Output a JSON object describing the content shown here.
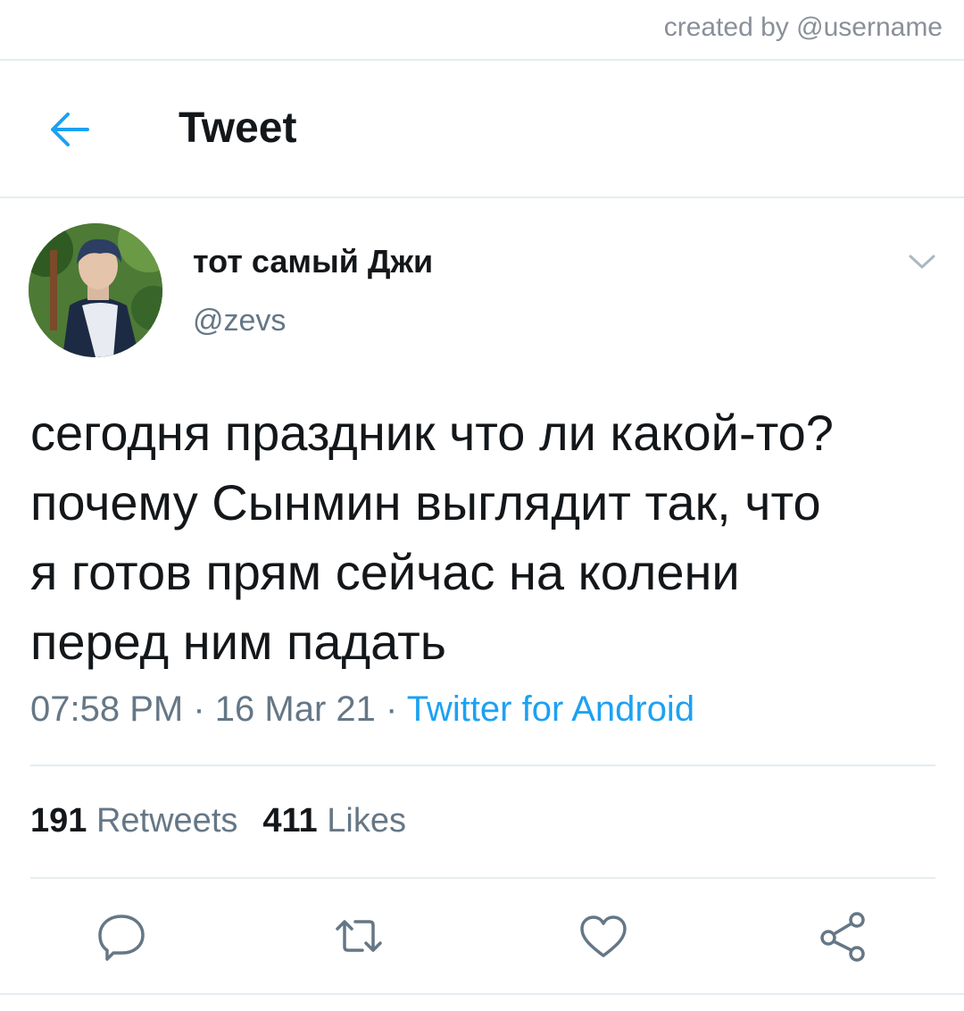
{
  "credit": "created by @username",
  "header": {
    "title": "Tweet"
  },
  "tweet": {
    "author_name": "тот самый Джи",
    "author_handle": "@zevs",
    "text_lines": [
      "сегодня праздник что ли какой-то?",
      "почему Сынмин выглядит так, что",
      "я готов прям сейчас на колени",
      "перед ним падать"
    ],
    "time": "07:58 PM",
    "date": "16 Mar 21",
    "source": "Twitter for Android",
    "retweets_count": "191",
    "retweets_label": "Retweets",
    "likes_count": "411",
    "likes_label": "Likes"
  },
  "icons": {
    "back": "arrow-left-icon",
    "menu": "chevron-down-icon",
    "reply": "comment-icon",
    "retweet": "retweet-icon",
    "like": "heart-icon",
    "share": "share-icon"
  },
  "colors": {
    "accent": "#1da1f2",
    "text": "#14171a",
    "secondary": "#657786",
    "divider": "#e6ecf0"
  }
}
